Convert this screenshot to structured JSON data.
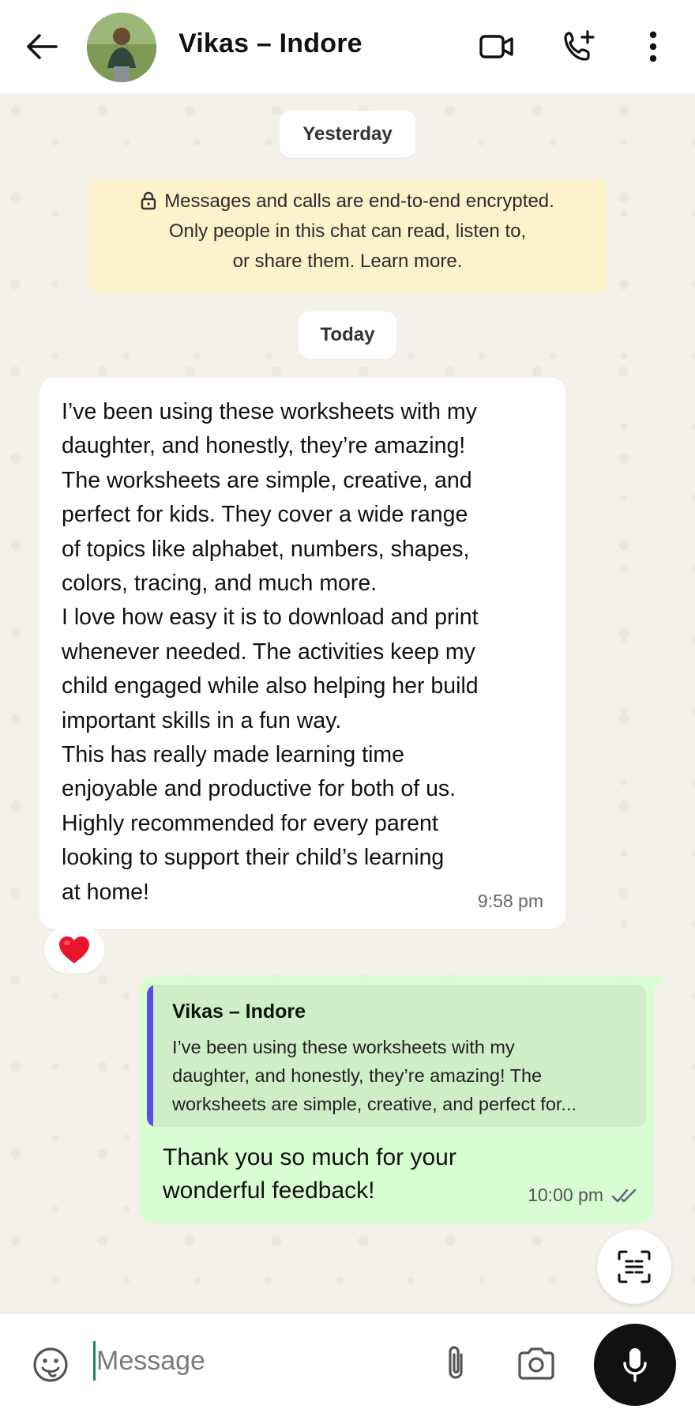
{
  "header": {
    "contact_name": "Vikas – Indore",
    "icons": [
      "back-arrow-icon",
      "video-call-icon",
      "add-call-icon",
      "more-vert-icon"
    ]
  },
  "chat": {
    "date_yesterday": "Yesterday",
    "encryption_notice": {
      "line1": "Messages and calls are end-to-end encrypted.",
      "line2": "Only people in this chat can read, listen to,",
      "line3": "or share them. Learn more."
    },
    "date_today": "Today",
    "incoming_message": {
      "lines": [
        "I’ve been using these worksheets with my",
        "daughter, and honestly, they’re amazing!",
        "The worksheets are simple, creative, and",
        "perfect for kids. They cover a wide range",
        "of topics like alphabet, numbers, shapes,",
        "colors, tracing, and much more.",
        "I love how easy it is to download and print",
        "whenever needed. The activities keep my",
        "child engaged while also helping her build",
        "important skills in a fun way.",
        "This has really made learning time",
        "enjoyable and productive for both of us.",
        "Highly recommended for every parent",
        "looking to support their child’s learning",
        "at home!"
      ],
      "time": "9:58 pm",
      "reaction": "❤️"
    },
    "outgoing_message": {
      "quote_name": "Vikas – Indore",
      "quote_lines": [
        "I’ve been using these worksheets with my",
        "daughter, and honestly, they’re amazing! The",
        "worksheets are simple, creative, and perfect for..."
      ],
      "text_lines": [
        "Thank you so much for your",
        "wonderful feedback!"
      ],
      "time": "10:00 pm",
      "status_icon": "double-check-icon"
    }
  },
  "input_bar": {
    "placeholder": "Message",
    "value": ""
  },
  "colors": {
    "chat_background": "#f4f1ea",
    "outgoing_bubble": "#d9fdd3",
    "quote_bar": "#5b4be8",
    "encryption_notice_bg": "#fdf2cc",
    "mic_button": "#111111"
  }
}
